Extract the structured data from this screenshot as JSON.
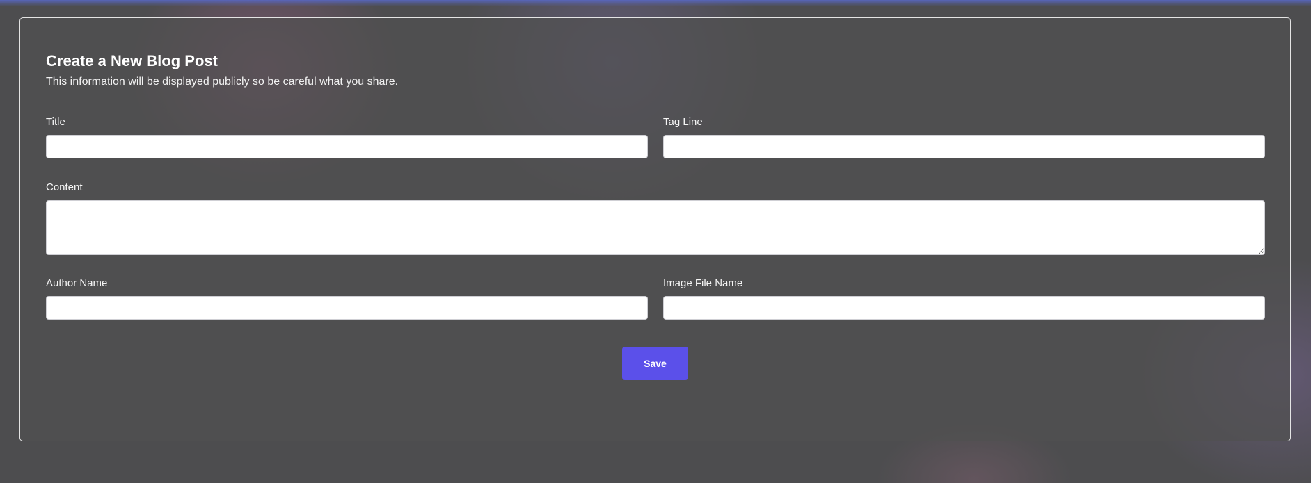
{
  "form": {
    "title": "Create a New Blog Post",
    "subtitle": "This information will be displayed publicly so be careful what you share.",
    "fields": {
      "title": {
        "label": "Title",
        "value": "",
        "placeholder": ""
      },
      "tagline": {
        "label": "Tag Line",
        "value": "",
        "placeholder": ""
      },
      "content": {
        "label": "Content",
        "value": "",
        "placeholder": ""
      },
      "author": {
        "label": "Author Name",
        "value": "",
        "placeholder": ""
      },
      "image": {
        "label": "Image File Name",
        "value": "",
        "placeholder": ""
      }
    },
    "save_label": "Save"
  },
  "colors": {
    "page_background": "#4d4d4f",
    "accent_button": "#5b50ea",
    "panel_border": "#ffffff"
  }
}
